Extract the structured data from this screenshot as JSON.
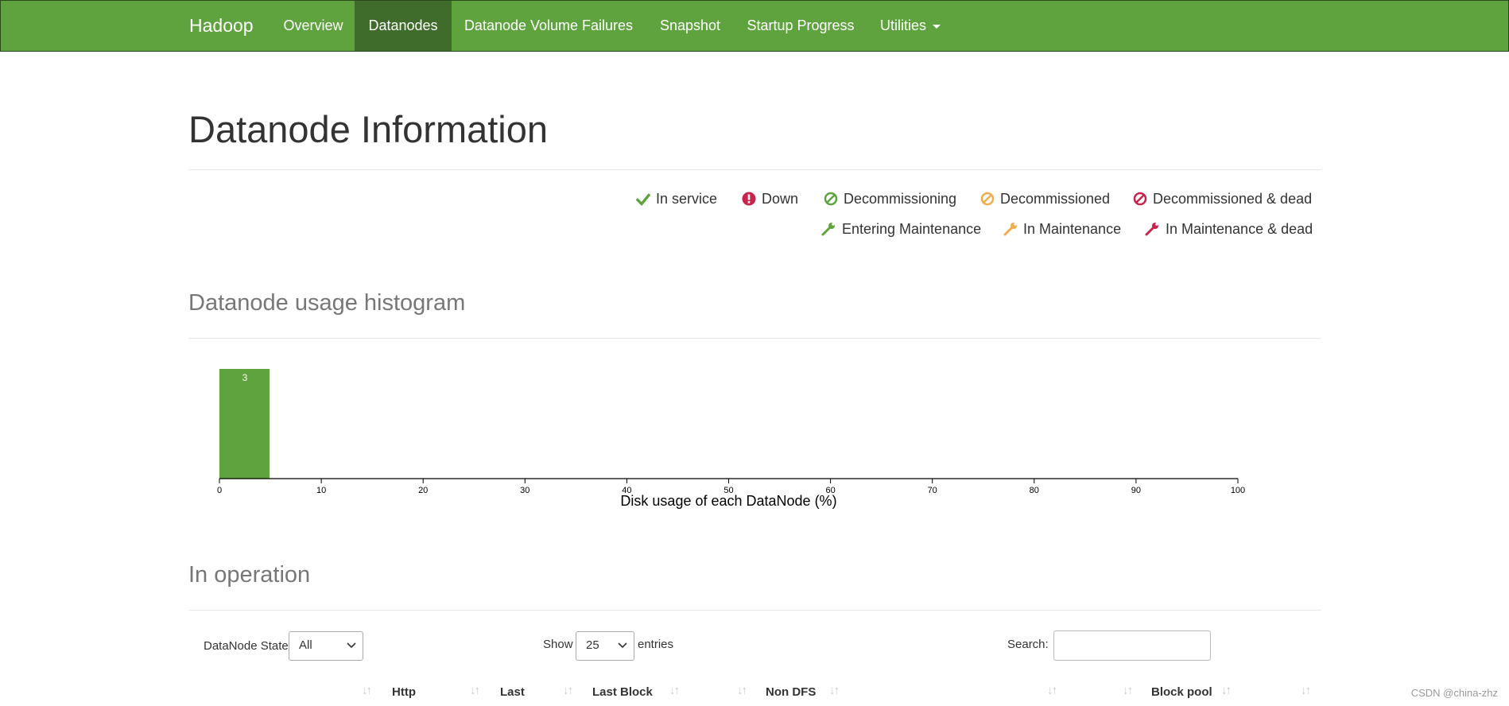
{
  "navbar": {
    "brand": "Hadoop",
    "items": [
      {
        "label": "Overview",
        "active": false
      },
      {
        "label": "Datanodes",
        "active": true
      },
      {
        "label": "Datanode Volume Failures",
        "active": false
      },
      {
        "label": "Snapshot",
        "active": false
      },
      {
        "label": "Startup Progress",
        "active": false
      },
      {
        "label": "Utilities",
        "active": false,
        "dropdown": true
      }
    ],
    "color": "#5fa33e",
    "active_color": "#3f6b2b"
  },
  "page": {
    "title": "Datanode Information"
  },
  "legend": [
    {
      "label": "In service",
      "icon": "check-icon",
      "color": "#5fa33e"
    },
    {
      "label": "Down",
      "icon": "exclamation-icon",
      "color": "#c7254e"
    },
    {
      "label": "Decommissioning",
      "icon": "ban-icon",
      "color": "#5fa33e"
    },
    {
      "label": "Decommissioned",
      "icon": "ban-icon",
      "color": "#f0ad4e"
    },
    {
      "label": "Decommissioned & dead",
      "icon": "ban-icon",
      "color": "#c7254e"
    },
    {
      "label": "Entering Maintenance",
      "icon": "wrench-icon",
      "color": "#5fa33e"
    },
    {
      "label": "In Maintenance",
      "icon": "wrench-icon",
      "color": "#f0ad4e"
    },
    {
      "label": "In Maintenance & dead",
      "icon": "wrench-icon",
      "color": "#c7254e"
    }
  ],
  "histogram": {
    "title": "Datanode usage histogram",
    "chart_data": {
      "type": "bar",
      "bins": [
        {
          "x0": 0,
          "x1": 5,
          "count": 3
        }
      ],
      "xlim": [
        0,
        100
      ],
      "xticks": [
        0,
        10,
        20,
        30,
        40,
        50,
        60,
        70,
        80,
        90,
        100
      ],
      "xlabel": "Disk usage of each DataNode (%)",
      "bar_color": "#5fa33e"
    }
  },
  "operation": {
    "title": "In operation",
    "state_label": "DataNode State",
    "state_value": "All",
    "show_label": "Show",
    "entries_value": "25",
    "entries_label": "entries",
    "search_label": "Search:",
    "search_value": "",
    "columns": [
      "Http",
      "Last",
      "Last Block",
      "Non DFS",
      "Block pool"
    ]
  },
  "watermark": "CSDN @china-zhz"
}
